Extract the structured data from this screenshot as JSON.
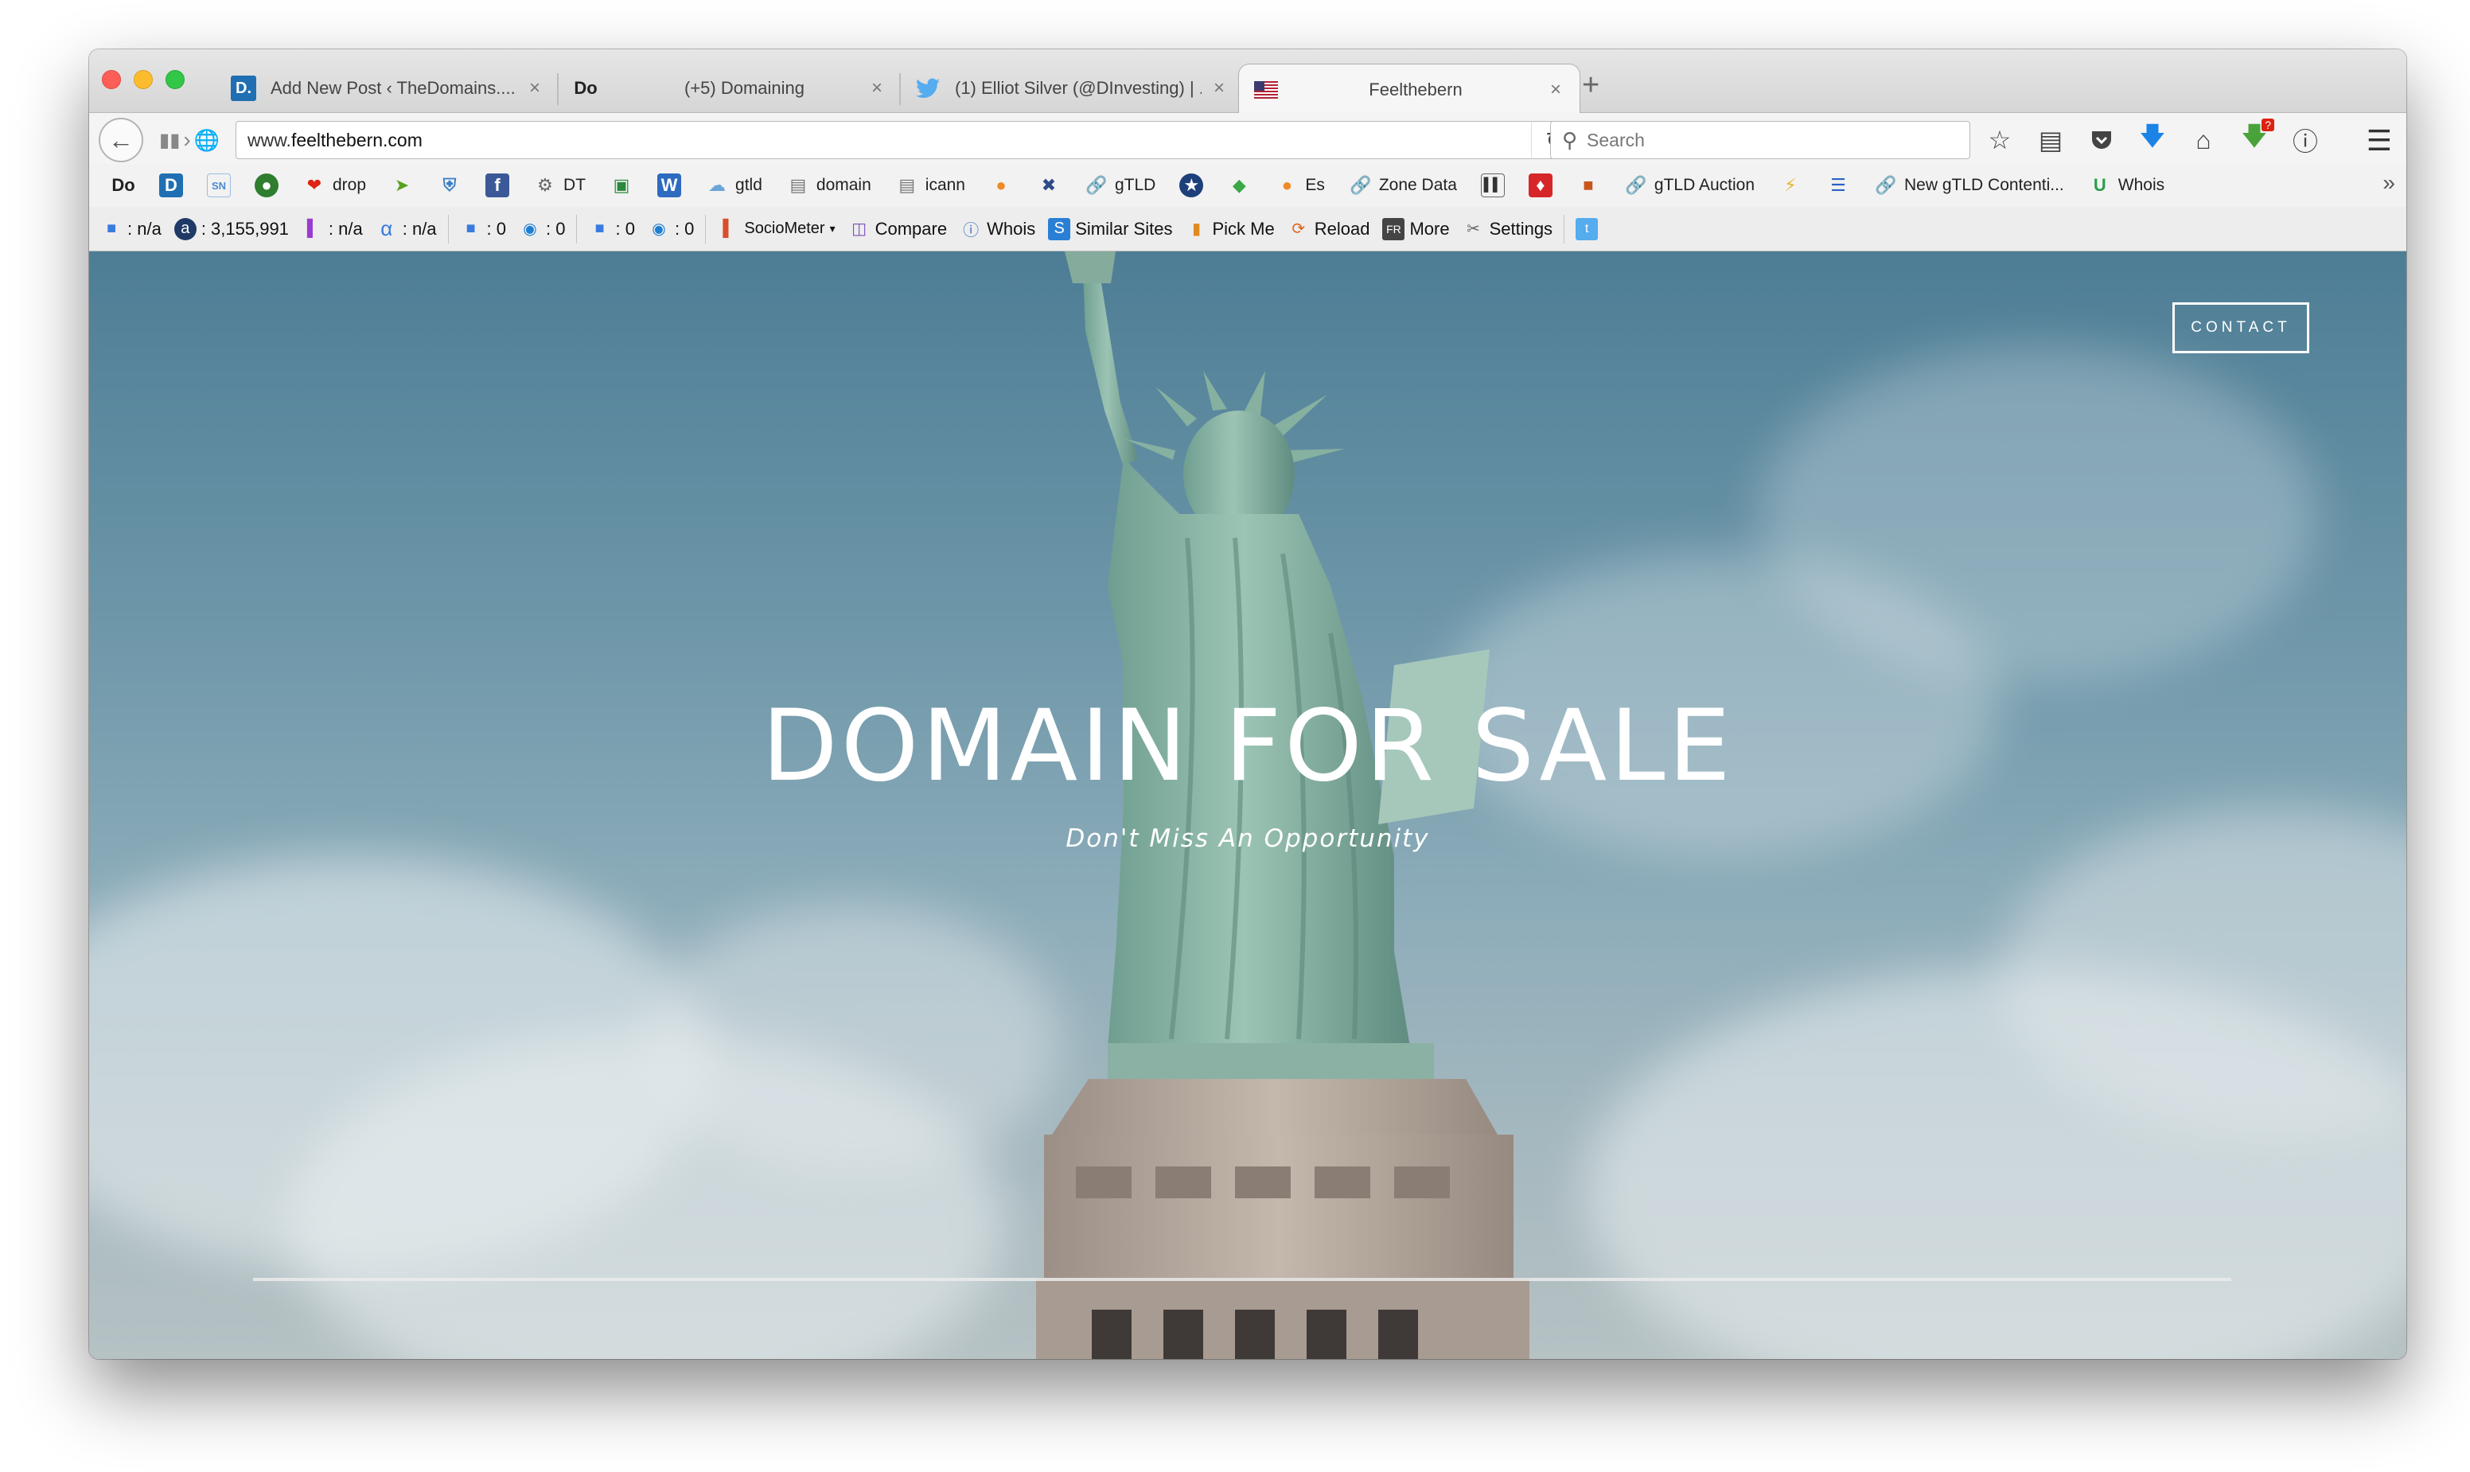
{
  "browser": {
    "tabs": [
      {
        "title": "Add New Post ‹ TheDomains....",
        "icon": "D.",
        "icon_color": "#1f6fb2"
      },
      {
        "title": "(+5) Domaining",
        "icon": "Do",
        "icon_color": "#222222"
      },
      {
        "title": "(1) Elliot Silver (@DInvesting) | ...",
        "icon": "twitter-bird",
        "icon_color": "#55acee"
      },
      {
        "title": "Feelthebern",
        "icon": "us-flag",
        "icon_color": "#b22234",
        "active": true
      }
    ],
    "new_tab_symbol": "+",
    "close_symbol": "×",
    "url": {
      "prefix": "www.",
      "host": "feelthebern.com"
    },
    "search_placeholder": "Search"
  },
  "bookmarks": [
    {
      "label": "",
      "icon": "Do"
    },
    {
      "label": "",
      "icon": "D"
    },
    {
      "label": "",
      "icon": "SN"
    },
    {
      "label": "",
      "icon": "globe"
    },
    {
      "label": "drop",
      "icon": "drop"
    },
    {
      "label": "",
      "icon": "arrow"
    },
    {
      "label": "",
      "icon": "shield"
    },
    {
      "label": "",
      "icon": "f"
    },
    {
      "label": "DT",
      "icon": "gear"
    },
    {
      "label": "",
      "icon": "image"
    },
    {
      "label": "",
      "icon": "W"
    },
    {
      "label": "gtld",
      "icon": "cloud"
    },
    {
      "label": "domain",
      "icon": "doc"
    },
    {
      "label": "icann",
      "icon": "doc"
    },
    {
      "label": "",
      "icon": "orange"
    },
    {
      "label": "",
      "icon": "x"
    },
    {
      "label": "gTLD",
      "icon": "link"
    },
    {
      "label": "",
      "icon": "star"
    },
    {
      "label": "",
      "icon": "green"
    },
    {
      "label": "Es",
      "icon": "orange"
    },
    {
      "label": "Zone Data",
      "icon": "link"
    },
    {
      "label": "",
      "icon": "chart"
    },
    {
      "label": "",
      "icon": "red"
    },
    {
      "label": "",
      "icon": "box"
    },
    {
      "label": "gTLD Auction",
      "icon": "link"
    },
    {
      "label": "",
      "icon": "bolt"
    },
    {
      "label": "",
      "icon": "lines"
    },
    {
      "label": "New gTLD Contenti...",
      "icon": "link"
    },
    {
      "label": "Whois",
      "icon": "U"
    }
  ],
  "seo_toolbar": {
    "items": [
      {
        "label": ": n/a",
        "icon": "google"
      },
      {
        "label": ": 3,155,991",
        "icon": "alexa"
      },
      {
        "label": ": n/a",
        "icon": "bars"
      },
      {
        "label": ": n/a",
        "icon": "alpha"
      },
      {
        "label": ": 0",
        "icon": "google"
      },
      {
        "label": ": 0",
        "icon": "eye"
      },
      {
        "label": ": 0",
        "icon": "google"
      },
      {
        "label": ": 0",
        "icon": "eye"
      }
    ],
    "links": [
      {
        "label": "SocioMeter",
        "icon": "bars",
        "dropdown": "▾"
      },
      {
        "label": "Compare",
        "icon": "compare"
      },
      {
        "label": "Whois",
        "icon": "question"
      },
      {
        "label": "Similar Sites",
        "icon": "S"
      },
      {
        "label": "Pick Me",
        "icon": "pick"
      },
      {
        "label": "Reload",
        "icon": "reload"
      },
      {
        "label": "More",
        "icon": "more"
      },
      {
        "label": "Settings",
        "icon": "settings"
      }
    ]
  },
  "page": {
    "contact_label": "CONTACT",
    "hero_title": "DOMAIN FOR SALE",
    "hero_subtitle": "Don't Miss An Opportunity"
  },
  "colors": {
    "sky_top": "#4d7d95",
    "statue": "#7fa99b",
    "pedestal": "#b7aaa0"
  }
}
